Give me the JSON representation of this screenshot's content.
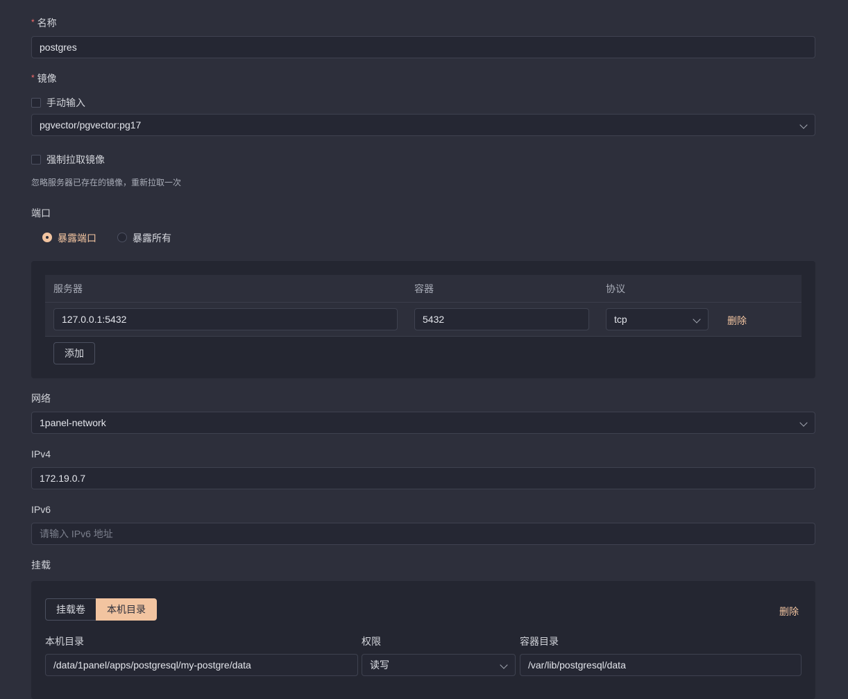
{
  "name": {
    "label": "名称",
    "value": "postgres"
  },
  "image": {
    "label": "镜像",
    "manual_input_label": "手动输入",
    "selected": "pgvector/pgvector:pg17",
    "force_pull_label": "强制拉取镜像",
    "force_pull_hint": "忽略服务器已存在的镜像，重新拉取一次"
  },
  "port": {
    "label": "端口",
    "mode_expose_ports": "暴露端口",
    "mode_expose_all": "暴露所有",
    "selected_mode": "暴露端口",
    "columns": {
      "server": "服务器",
      "container": "容器",
      "protocol": "协议"
    },
    "rows": [
      {
        "server": "127.0.0.1:5432",
        "container": "5432",
        "protocol": "tcp",
        "delete_label": "删除"
      }
    ],
    "add_label": "添加"
  },
  "network": {
    "label": "网络",
    "selected": "1panel-network"
  },
  "ipv4": {
    "label": "IPv4",
    "value": "172.19.0.7"
  },
  "ipv6": {
    "label": "IPv6",
    "value": "",
    "placeholder": "请输入 IPv6 地址"
  },
  "mount": {
    "label": "挂载",
    "tab_volume": "挂载卷",
    "tab_host_dir": "本机目录",
    "active_tab": "本机目录",
    "delete_label": "删除",
    "columns": {
      "host_dir": "本机目录",
      "permission": "权限",
      "container_dir": "容器目录"
    },
    "rows": [
      {
        "host_dir": "/data/1panel/apps/postgresql/my-postgre/data",
        "permission": "读写",
        "container_dir": "/var/lib/postgresql/data"
      }
    ]
  },
  "colors": {
    "accent": "#f2c4a0",
    "background": "#2d2f3b",
    "panel": "#242631",
    "required": "#f56c6c"
  }
}
